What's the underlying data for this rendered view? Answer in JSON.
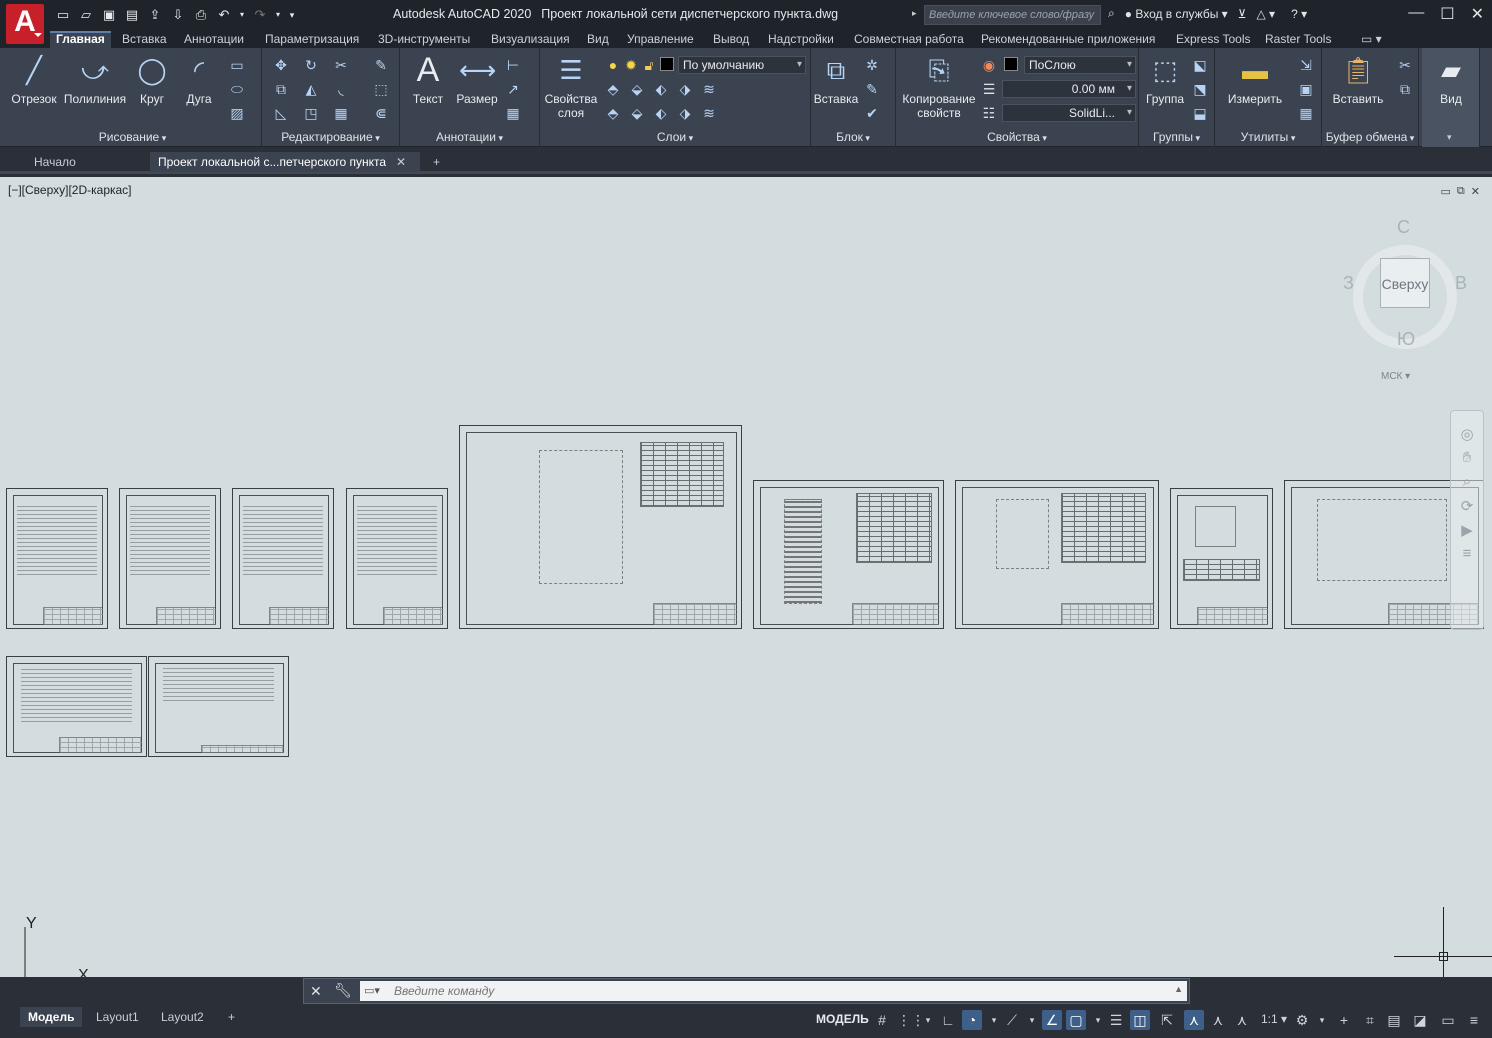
{
  "app": {
    "title": "Autodesk AutoCAD 2020",
    "document": "Проект локальной сети диспетчерского пункта.dwg",
    "logo_letter": "A",
    "search_placeholder": "Введите ключевое слово/фразу",
    "signin": "Вход в службы",
    "accent": "#c8202a"
  },
  "ribbon_tabs": [
    "Главная",
    "Вставка",
    "Аннотации",
    "Параметризация",
    "3D-инструменты",
    "Визуализация",
    "Вид",
    "Управление",
    "Вывод",
    "Надстройки",
    "Совместная работа",
    "Рекомендованные приложения",
    "Express Tools",
    "Raster Tools"
  ],
  "panels": {
    "draw": {
      "title": "Рисование",
      "tools": [
        "Отрезок",
        "Полилиния",
        "Круг",
        "Дуга"
      ]
    },
    "modify": {
      "title": "Редактирование"
    },
    "annotation": {
      "title": "Аннотации",
      "tools": [
        "Текст",
        "Размер"
      ]
    },
    "layers": {
      "title": "Слои",
      "tool": "Свойства слоя",
      "layer_value": "По умолчанию"
    },
    "block": {
      "title": "Блок",
      "tool": "Вставка"
    },
    "properties": {
      "title": "Свойства",
      "tool": "Копирование свойств",
      "color": "ПоСлою",
      "lineweight": "0.00 мм",
      "linetype": "SolidLi..."
    },
    "groups": {
      "title": "Группы",
      "tool": "Группа"
    },
    "utilities": {
      "title": "Утилиты",
      "tool": "Измерить"
    },
    "clipboard": {
      "title": "Буфер обмена",
      "tool": "Вставить"
    },
    "view": {
      "tool": "Вид"
    }
  },
  "file_tabs": {
    "start": "Начало",
    "active": "Проект локальной с...петчерского пункта"
  },
  "viewport": {
    "label": "[−][Сверху][2D-каркас]"
  },
  "viewcube": {
    "north": "С",
    "south": "Ю",
    "west": "З",
    "east": "В",
    "top": "Сверху",
    "wcs": "МСК"
  },
  "ucs": {
    "x": "X",
    "y": "Y"
  },
  "command": {
    "placeholder": "Введите команду"
  },
  "layout_tabs": [
    "Модель",
    "Layout1",
    "Layout2"
  ],
  "status": {
    "model": "МОДЕЛЬ",
    "scale": "1:1"
  }
}
